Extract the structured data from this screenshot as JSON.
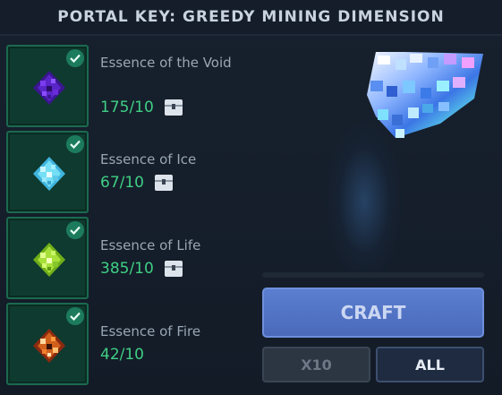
{
  "title": "PORTAL KEY: GREEDY MINING DIMENSION",
  "requirements": [
    {
      "name": "Essence of the Void",
      "count": "175/10",
      "icon": "void-essence-icon",
      "color": "#6a2bd9",
      "satisfied": true,
      "has_storage_icon": true
    },
    {
      "name": "Essence of Ice",
      "count": "67/10",
      "icon": "ice-essence-icon",
      "color": "#6fd8f2",
      "satisfied": true,
      "has_storage_icon": true
    },
    {
      "name": "Essence of Life",
      "count": "385/10",
      "icon": "life-essence-icon",
      "color": "#a8e03a",
      "satisfied": true,
      "has_storage_icon": true
    },
    {
      "name": "Essence of Fire",
      "count": "42/10",
      "icon": "fire-essence-icon",
      "color": "#e0701e",
      "satisfied": true,
      "has_storage_icon": false
    }
  ],
  "buttons": {
    "craft": "CRAFT",
    "x10": "X10",
    "all": "ALL"
  },
  "preview": {
    "icon": "portal-key-icon"
  },
  "colors": {
    "accent_green": "#3fcf84",
    "craft_blue": "#5277c8",
    "slot_bg": "#0f3a2f"
  }
}
